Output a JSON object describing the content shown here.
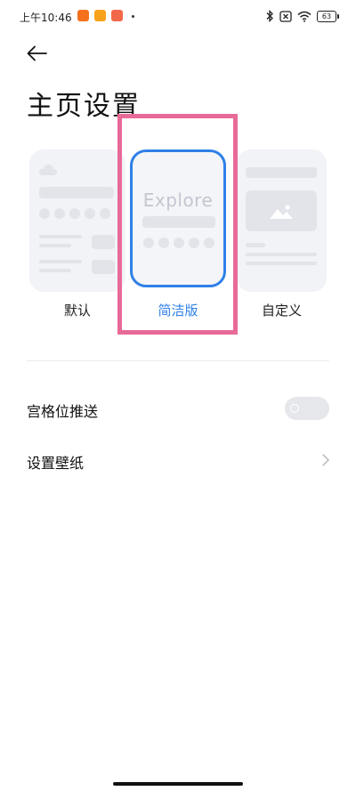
{
  "status_bar": {
    "time": "上午10:46",
    "app_icons": [
      {
        "name": "taobao-app-icon",
        "color": "#f5711d"
      },
      {
        "name": "weibo-app-icon",
        "color": "#f7a21b"
      },
      {
        "name": "shop-app-icon",
        "color": "#f2684a"
      }
    ],
    "battery": "63"
  },
  "header": {
    "title": "主页设置"
  },
  "layouts": {
    "default": {
      "label": "默认"
    },
    "simple": {
      "label": "简洁版",
      "preview_text": "Explore",
      "selected": true
    },
    "custom": {
      "label": "自定义"
    }
  },
  "settings": {
    "grid_push": {
      "label": "宫格位推送",
      "enabled": false
    },
    "wallpaper": {
      "label": "设置壁纸"
    }
  },
  "colors": {
    "accent": "#2f80e8",
    "highlight": "#e86a98"
  }
}
